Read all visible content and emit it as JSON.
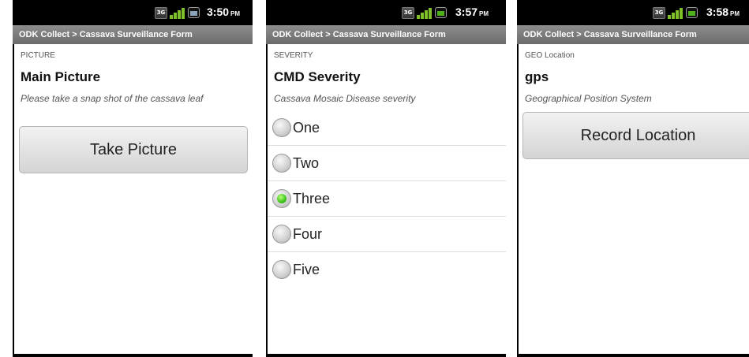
{
  "screens": [
    {
      "status": {
        "time": "3:50",
        "ampm": "PM"
      },
      "title": "ODK Collect > Cassava Surveillance Form",
      "group": "PICTURE",
      "question": "Main Picture",
      "hint": "Please take a snap shot of the cassava leaf",
      "button": "Take Picture"
    },
    {
      "status": {
        "time": "3:57",
        "ampm": "PM"
      },
      "title": "ODK Collect > Cassava Surveillance Form",
      "group": "SEVERITY",
      "question": "CMD Severity",
      "hint": "Cassava Mosaic Disease severity",
      "options": [
        "One",
        "Two",
        "Three",
        "Four",
        "Five"
      ],
      "selected": "Three"
    },
    {
      "status": {
        "time": "3:58",
        "ampm": "PM"
      },
      "title": "ODK Collect > Cassava Surveillance Form",
      "group": "GEO Location",
      "question": "gps",
      "hint": "Geographical Position System",
      "button": "Record Location"
    }
  ],
  "icons": [
    "3g-icon",
    "signal-icon",
    "battery-icon"
  ],
  "colors": {
    "title_bar": "#7a7a7a",
    "radio_selected": "#3cc41a"
  }
}
